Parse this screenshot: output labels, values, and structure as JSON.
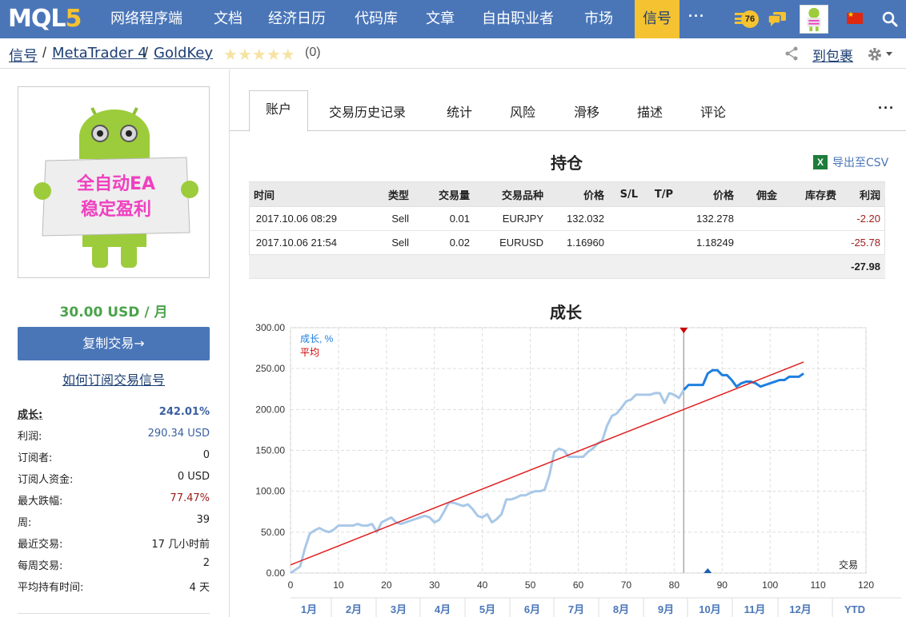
{
  "nav": {
    "logo_main": "MQL",
    "logo_digit": "5",
    "items": [
      "网络程序端",
      "文档",
      "经济日历",
      "代码库",
      "文章",
      "自由职业者",
      "市场",
      "信号"
    ],
    "more": "···",
    "badge_count": "76"
  },
  "breadcrumb": {
    "items": [
      "信号",
      "MetaTrader 4",
      "GoldKey"
    ],
    "separator": "/",
    "rating_count": "(0)",
    "cart_label": "到包裹"
  },
  "sidebar": {
    "sign_line1": "全自动EA",
    "sign_line2": "稳定盈利",
    "price": "30.00 USD / 月",
    "copy_button": "复制交易→",
    "howto_link": "如何订阅交易信号",
    "stats": [
      {
        "label": "成长:",
        "value": "242.01%",
        "color": "#3a5fa0"
      },
      {
        "label": "利润:",
        "value": "290.34 USD",
        "color": "#3a5fa0"
      },
      {
        "label": "订阅者:",
        "value": "0",
        "color": "#222222"
      },
      {
        "label": "订阅人资金:",
        "value": "0 USD",
        "color": "#222222"
      },
      {
        "label": "最大跌幅:",
        "value": "77.47%",
        "color": "#a01e1e"
      },
      {
        "label": "周:",
        "value": "39",
        "color": "#222222"
      },
      {
        "label": "最近交易:",
        "value": "17 几小时前",
        "color": "#222222"
      },
      {
        "label": "每周交易:",
        "value": "2",
        "color": "#222222"
      },
      {
        "label": "平均持有时间:",
        "value": "4 天",
        "color": "#222222"
      }
    ]
  },
  "tabs": [
    "账户",
    "交易历史记录",
    "统计",
    "风险",
    "滑移",
    "描述",
    "评论"
  ],
  "tabs_more": "···",
  "positions": {
    "title": "持仓",
    "export_label": "导出至CSV",
    "columns": [
      "时间",
      "类型",
      "交易量",
      "交易品种",
      "价格",
      "S/L",
      "T/P",
      "价格",
      "佣金",
      "库存费",
      "利润"
    ],
    "rows": [
      [
        "2017.10.06 08:29",
        "Sell",
        "0.01",
        "EURJPY",
        "132.032",
        "",
        "",
        "132.278",
        "",
        "",
        "-2.20"
      ],
      [
        "2017.10.06 21:54",
        "Sell",
        "0.02",
        "EURUSD",
        "1.16960",
        "",
        "",
        "1.18249",
        "",
        "",
        "-25.78"
      ]
    ],
    "total": "-27.98"
  },
  "chart_data": {
    "type": "line",
    "title": "成长",
    "legend": [
      "成长, %",
      "平均"
    ],
    "legend_position": "top-left",
    "xlabel": "交易",
    "ylabel": "",
    "x_ticks": [
      0,
      10,
      20,
      30,
      40,
      50,
      60,
      70,
      80,
      90,
      100,
      110,
      120
    ],
    "y_ticks": [
      "0.00",
      "50.00",
      "100.00",
      "150.00",
      "200.00",
      "250.00",
      "300.00"
    ],
    "xlim": [
      0,
      120
    ],
    "ylim": [
      0,
      300
    ],
    "grid": true,
    "months": [
      "1月",
      "2月",
      "3月",
      "4月",
      "5月",
      "6月",
      "7月",
      "8月",
      "9月",
      "10月",
      "11月",
      "12月",
      "YTD"
    ],
    "marker_x": 82,
    "series": [
      {
        "name": "成长, %",
        "color": "#a9c8e8",
        "x": [
          0,
          2,
          3,
          4,
          5,
          6,
          7,
          8,
          9,
          10,
          11,
          12,
          13,
          14,
          15,
          16,
          17,
          18,
          19,
          20,
          21,
          22,
          23,
          24,
          25,
          26,
          27,
          28,
          29,
          30,
          31,
          32,
          33,
          34,
          35,
          36,
          37,
          38,
          39,
          40,
          41,
          42,
          43,
          44,
          45,
          46,
          47,
          48,
          49,
          50,
          51,
          52,
          53,
          54,
          55,
          56,
          57,
          58,
          59,
          60,
          61,
          62,
          63,
          64,
          65,
          66,
          67,
          68,
          69,
          70,
          71,
          72,
          73,
          74,
          75,
          76,
          77,
          78,
          79,
          80,
          81,
          82
        ],
        "y": [
          0,
          8,
          30,
          48,
          52,
          55,
          52,
          50,
          53,
          58,
          58,
          58,
          58,
          60,
          58,
          58,
          60,
          50,
          62,
          65,
          68,
          62,
          60,
          62,
          64,
          66,
          68,
          70,
          68,
          62,
          65,
          75,
          86,
          86,
          84,
          82,
          84,
          78,
          70,
          68,
          72,
          62,
          66,
          72,
          90,
          90,
          92,
          95,
          95,
          98,
          100,
          100,
          102,
          120,
          148,
          152,
          150,
          142,
          142,
          142,
          142,
          148,
          152,
          158,
          162,
          180,
          192,
          195,
          202,
          210,
          212,
          218,
          218,
          218,
          218,
          220,
          220,
          208,
          220,
          218,
          214,
          224
        ]
      },
      {
        "name": "成长, % (recent)",
        "color": "#1e7fe0",
        "x": [
          82,
          83,
          84,
          85,
          86,
          87,
          88,
          89,
          90,
          91,
          92,
          93,
          94,
          95,
          96,
          97,
          98,
          99,
          100,
          101,
          102,
          103,
          104,
          105,
          106,
          107
        ],
        "y": [
          224,
          230,
          230,
          230,
          230,
          244,
          248,
          248,
          242,
          242,
          236,
          228,
          232,
          234,
          234,
          232,
          228,
          230,
          232,
          234,
          236,
          236,
          240,
          240,
          240,
          244
        ]
      },
      {
        "name": "平均",
        "color": "#e02020",
        "x": [
          0,
          107
        ],
        "y": [
          10,
          258
        ]
      }
    ]
  }
}
